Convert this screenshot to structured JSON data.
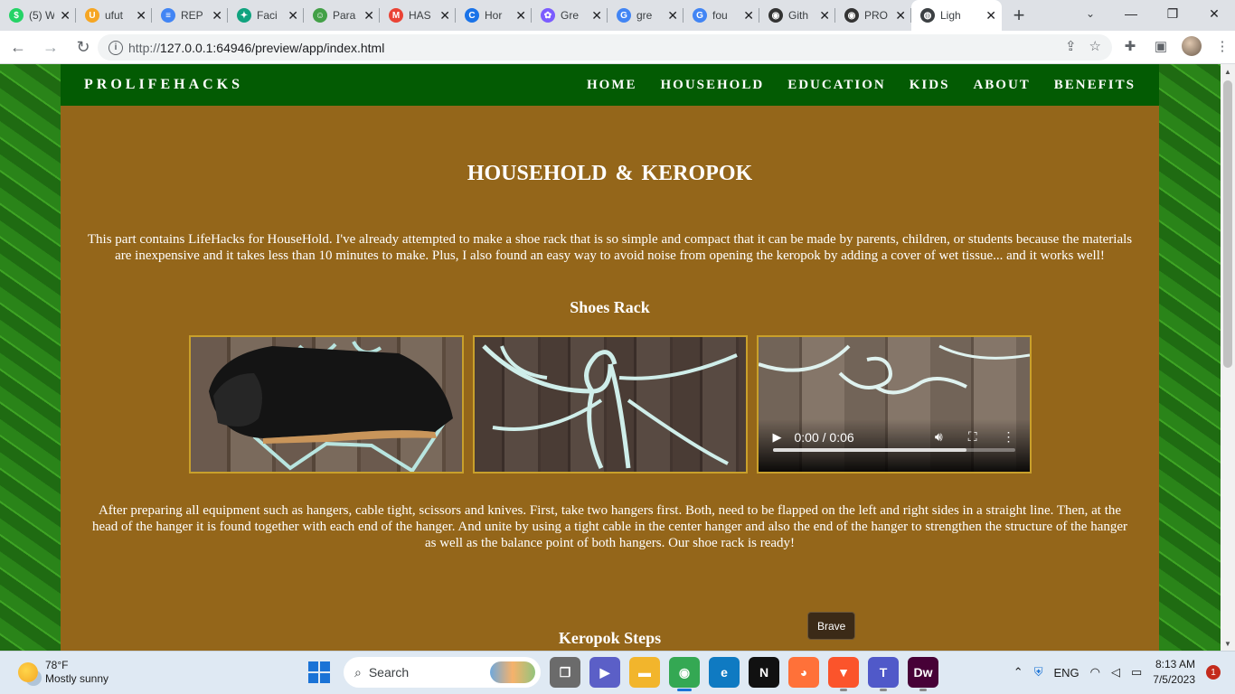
{
  "browser": {
    "tabs": [
      {
        "title": "(5) W",
        "fav_color": "#25d366",
        "fav_glyph": "$"
      },
      {
        "title": "ufut",
        "fav_color": "#f6a623",
        "fav_glyph": "U"
      },
      {
        "title": "REP",
        "fav_color": "#4285f4",
        "fav_glyph": "≡"
      },
      {
        "title": "Faci",
        "fav_color": "#10a37f",
        "fav_glyph": "✦"
      },
      {
        "title": "Para",
        "fav_color": "#43a047",
        "fav_glyph": "☺"
      },
      {
        "title": "HAS",
        "fav_color": "#ea4335",
        "fav_glyph": "M"
      },
      {
        "title": "Hor",
        "fav_color": "#1a73e8",
        "fav_glyph": "C"
      },
      {
        "title": "Gre",
        "fav_color": "#7b5cff",
        "fav_glyph": "✿"
      },
      {
        "title": "gre",
        "fav_color": "#4285f4",
        "fav_glyph": "G"
      },
      {
        "title": "fou",
        "fav_color": "#4285f4",
        "fav_glyph": "G"
      },
      {
        "title": "Gith",
        "fav_color": "#333333",
        "fav_glyph": "◉"
      },
      {
        "title": "PRO",
        "fav_color": "#333333",
        "fav_glyph": "◉"
      }
    ],
    "active_tab": {
      "title": "Ligh",
      "fav_color": "#3c4043",
      "fav_glyph": "◍"
    },
    "url": "127.0.0.1:64946/preview/app/index.html",
    "url_scheme": "http://"
  },
  "site": {
    "brand": "PROLIFEHACKS",
    "menu": [
      "HOME",
      "HOUSEHOLD",
      "EDUCATION",
      "KIDS",
      "ABOUT",
      "BENEFITS"
    ],
    "title": "HOUSEHOLD & KEROPOK",
    "intro": "This part contains LifeHacks for HouseHold. I've already attempted to make a shoe rack that is so simple and compact that it can be made by parents, children, or students because the materials are inexpensive and it takes less than 10 minutes to make. Plus, I also found an easy way to avoid noise from opening the keropok by adding a cover of wet tissue... and it works well!",
    "section1": "Shoes Rack",
    "video": {
      "time": "0:00 / 0:06",
      "buffered": 0.8
    },
    "steps": "After preparing all equipment such as hangers, cable tight, scissors and knives. First, take two hangers first. Both, need to be flapped on the left and right sides in a straight line. Then, at the head of the hanger it is found together with each end of the hanger. And unite by using a tight cable in the center hanger and also the end of the hanger to strengthen the structure of the hanger as well as the balance point of both hangers. Our shoe rack is ready!",
    "section2": "Keropok Steps",
    "colors": {
      "nav": "#035b03",
      "body": "#94661a",
      "frame": "#c9a02b"
    }
  },
  "tooltip": "Brave",
  "taskbar": {
    "weather_temp": "78°F",
    "weather_desc": "Mostly sunny",
    "search_label": "Search",
    "apps": [
      {
        "name": "task-view",
        "glyph": "❐",
        "color": "#6b6b6b"
      },
      {
        "name": "meet",
        "glyph": "▶",
        "color": "#5b5fc7"
      },
      {
        "name": "file-explorer",
        "glyph": "▬",
        "color": "#f2b52c"
      },
      {
        "name": "chrome",
        "glyph": "◉",
        "color": "#34a853"
      },
      {
        "name": "edge",
        "glyph": "e",
        "color": "#0f7ac2"
      },
      {
        "name": "netflix",
        "glyph": "N",
        "color": "#111111"
      },
      {
        "name": "firefox",
        "glyph": "◕",
        "color": "#ff7139"
      },
      {
        "name": "brave",
        "glyph": "▼",
        "color": "#fb542b"
      },
      {
        "name": "teams",
        "glyph": "T",
        "color": "#5059c9"
      },
      {
        "name": "dreamweaver",
        "glyph": "Dw",
        "color": "#470137"
      }
    ],
    "lang": "ENG",
    "time": "8:13 AM",
    "date": "7/5/2023",
    "notifications": "1"
  }
}
